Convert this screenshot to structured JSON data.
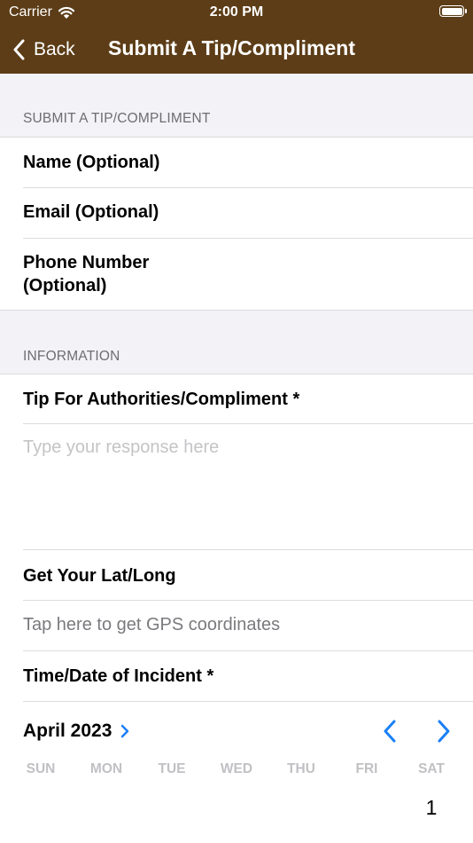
{
  "status_bar": {
    "carrier": "Carrier",
    "time": "2:00 PM"
  },
  "nav": {
    "back_label": "Back",
    "title": "Submit A Tip/Compliment"
  },
  "sections": {
    "contact_header": "SUBMIT A TIP/COMPLIMENT",
    "info_header": "INFORMATION"
  },
  "fields": {
    "name_label": "Name (Optional)",
    "email_label": "Email (Optional)",
    "phone_label_line1": "Phone Number",
    "phone_label_line2": "(Optional)",
    "tip_label": "Tip For Authorities/Compliment *",
    "tip_placeholder": "Type your response here",
    "latlong_label": "Get Your Lat/Long",
    "gps_action": "Tap here to get GPS coordinates",
    "incident_label": "Time/Date of Incident *"
  },
  "calendar": {
    "month_label": "April 2023",
    "weekdays": [
      "SUN",
      "MON",
      "TUE",
      "WED",
      "THU",
      "FRI",
      "SAT"
    ],
    "first_day": "1",
    "accent": "#1a7ff5"
  }
}
